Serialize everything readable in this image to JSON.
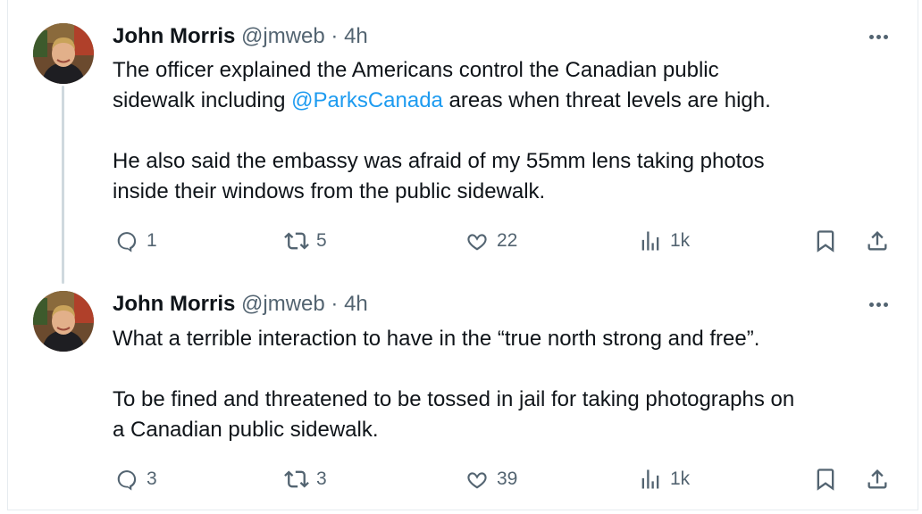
{
  "tweets": [
    {
      "name": "John Morris",
      "handle": "@jmweb",
      "separator": "·",
      "time": "4h",
      "body": {
        "p1_before": "The officer explained the Americans control the Canadian public",
        "p1_line2_before": "sidewalk including ",
        "p1_mention": "@ParksCanada",
        "p1_line2_after": " areas when threat levels are high.",
        "p2_line1": "He also said the embassy was afraid of my 55mm lens taking photos",
        "p2_line2": "inside their windows from the public sidewalk."
      },
      "actions": {
        "replies": "1",
        "reposts": "5",
        "likes": "22",
        "views": "1k"
      }
    },
    {
      "name": "John Morris",
      "handle": "@jmweb",
      "separator": "·",
      "time": "4h",
      "body": {
        "p1_line1": "What a terrible interaction to have in the “true north strong and free”.",
        "p2_line1": "To be fined and threatened to be tossed in jail for taking photographs on",
        "p2_line2": "a Canadian public sidewalk."
      },
      "actions": {
        "replies": "3",
        "reposts": "3",
        "likes": "39",
        "views": "1k"
      }
    }
  ],
  "icons": {
    "reply": "reply-icon",
    "repost": "repost-icon",
    "like": "heart-icon",
    "views": "views-icon",
    "bookmark": "bookmark-icon",
    "share": "share-icon",
    "more": "more-icon"
  },
  "colors": {
    "text": "#0f1419",
    "secondary": "#536471",
    "link": "#1d9bf0",
    "thread_line": "#cfd9de"
  }
}
